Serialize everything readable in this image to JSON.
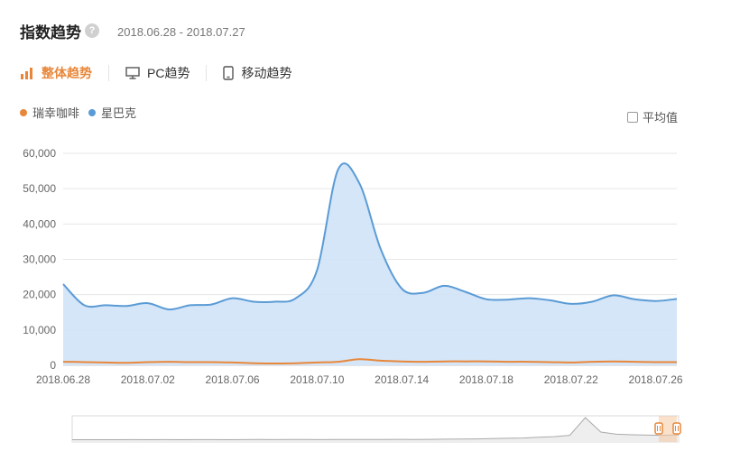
{
  "header": {
    "title": "指数趋势",
    "help_glyph": "?",
    "date_range": "2018.06.28 - 2018.07.27"
  },
  "tabs": [
    {
      "label": "整体趋势",
      "icon": "bar-chart-icon",
      "active": true
    },
    {
      "label": "PC趋势",
      "icon": "monitor-icon",
      "active": false
    },
    {
      "label": "移动趋势",
      "icon": "mobile-phone-icon",
      "active": false
    }
  ],
  "legend": [
    {
      "label": "瑞幸咖啡",
      "color": "#e8873a"
    },
    {
      "label": "星巴克",
      "color": "#5b9bd5"
    }
  ],
  "average_toggle": {
    "label": "平均值",
    "checked": false
  },
  "chart_data": {
    "type": "area",
    "x": [
      "2018.06.28",
      "2018.06.29",
      "2018.06.30",
      "2018.07.01",
      "2018.07.02",
      "2018.07.03",
      "2018.07.04",
      "2018.07.05",
      "2018.07.06",
      "2018.07.07",
      "2018.07.08",
      "2018.07.09",
      "2018.07.10",
      "2018.07.11",
      "2018.07.12",
      "2018.07.13",
      "2018.07.14",
      "2018.07.15",
      "2018.07.16",
      "2018.07.17",
      "2018.07.18",
      "2018.07.19",
      "2018.07.20",
      "2018.07.21",
      "2018.07.22",
      "2018.07.23",
      "2018.07.24",
      "2018.07.25",
      "2018.07.26",
      "2018.07.27"
    ],
    "x_tick_labels": [
      "2018.06.28",
      "2018.07.02",
      "2018.07.06",
      "2018.07.10",
      "2018.07.14",
      "2018.07.18",
      "2018.07.22",
      "2018.07.26"
    ],
    "y_tick_labels": [
      "0",
      "10,000",
      "20,000",
      "30,000",
      "40,000",
      "50,000",
      "60,000"
    ],
    "ylim": [
      0,
      60000
    ],
    "grid": true,
    "series": [
      {
        "name": "星巴克",
        "color": "#5b9bd5",
        "fill": "#cfe3f7",
        "values": [
          23000,
          17000,
          17000,
          16800,
          17600,
          15800,
          17000,
          17200,
          19000,
          18000,
          18000,
          19000,
          27000,
          55500,
          51500,
          33000,
          21700,
          20500,
          22500,
          20800,
          18700,
          18600,
          19000,
          18400,
          17400,
          18000,
          19800,
          18700,
          18200,
          18800
        ]
      },
      {
        "name": "瑞幸咖啡",
        "color": "#e8873a",
        "values": [
          1000,
          900,
          800,
          700,
          900,
          1000,
          900,
          900,
          800,
          600,
          500,
          600,
          800,
          1000,
          1700,
          1300,
          1100,
          1000,
          1100,
          1100,
          1100,
          1000,
          1000,
          900,
          800,
          1000,
          1100,
          1000,
          900,
          900
        ]
      }
    ],
    "navigator_series": [
      2000,
      2000,
      2000,
      2000,
      2100,
      2000,
      2100,
      2000,
      2100,
      2100,
      2000,
      2100,
      2200,
      2100,
      2200,
      2200,
      2100,
      2200,
      2300,
      2200,
      2300,
      2400,
      2300,
      2400,
      2500,
      2600,
      2800,
      3000,
      3300,
      3600,
      4200,
      4800,
      6000,
      22000,
      9000,
      7000,
      6500,
      6200,
      6000,
      6400
    ]
  }
}
